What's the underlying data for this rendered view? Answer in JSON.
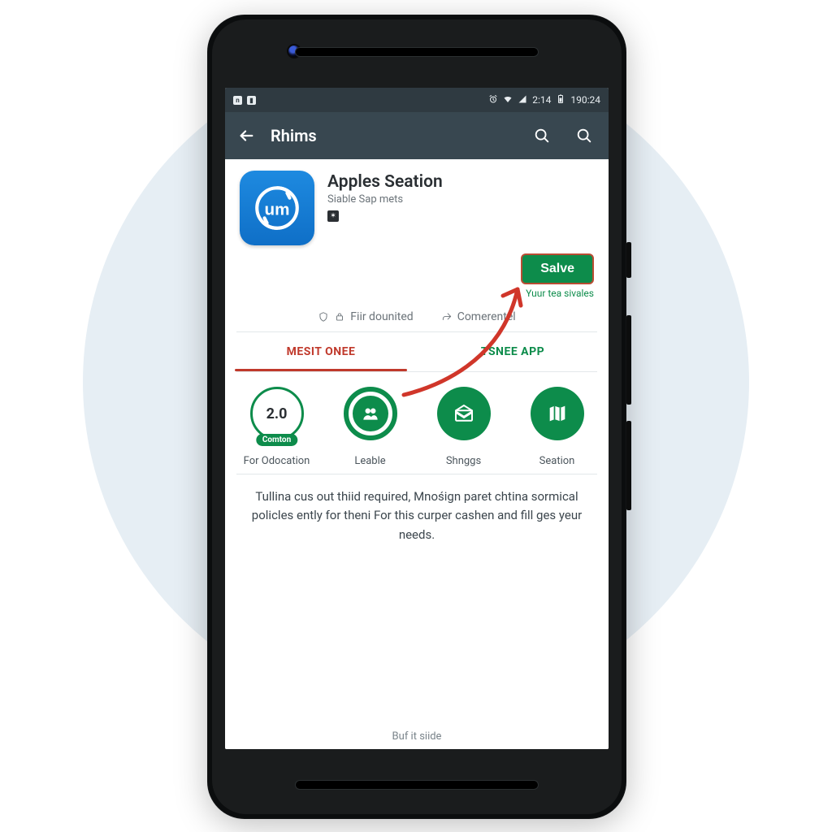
{
  "statusbar": {
    "signal_text": "2:14",
    "time": "190:24"
  },
  "appbar": {
    "title": "Rhims"
  },
  "app": {
    "title": "Apples Seation",
    "subtitle": "Siable Sap mets"
  },
  "cta": {
    "label": "Salve",
    "note": "Yuur tea sivales"
  },
  "chips": {
    "left": "Fiir dounited",
    "right": "Comerentel"
  },
  "tabs": {
    "left": "MESIT ONEE",
    "right": "TSNEE APP"
  },
  "features": [
    {
      "value": "2.0",
      "pill": "Comton",
      "label": "For Odocation"
    },
    {
      "label": "Leable"
    },
    {
      "label": "Shnggs"
    },
    {
      "label": "Seation"
    }
  ],
  "description": "Tullina cus out thiid required, Mnośign paret chtina sormical policles ently for theni For this curper cashen and fill ges yeur needs.",
  "footer": "Buf it siide",
  "colors": {
    "accent": "#0d8c4b",
    "danger": "#c0392b",
    "appbar": "#384750"
  }
}
